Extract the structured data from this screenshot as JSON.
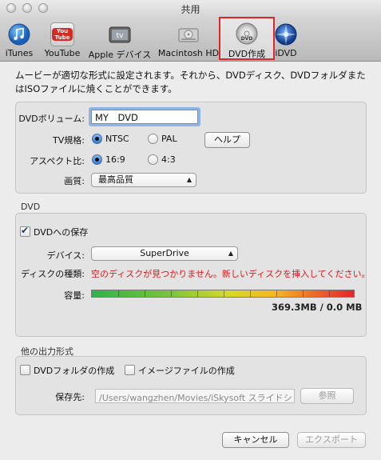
{
  "window": {
    "title": "共用"
  },
  "toolbar": {
    "items": [
      {
        "label": "iTunes"
      },
      {
        "label": "YouTube",
        "icon_text": "You Tube"
      },
      {
        "label": "Apple デバイス"
      },
      {
        "label": "Macintosh HD"
      },
      {
        "label": "DVD作成",
        "icon_text": "DVD",
        "selected": true
      },
      {
        "label": "iDVD"
      }
    ]
  },
  "description": "ムービーが適切な形式に設定されます。それから、DVDディスク、DVDフォルダまたはISOファイルに焼くことができます。",
  "settings": {
    "volume_label": "DVDボリューム:",
    "volume_value": "MY　DVD",
    "tv_label": "TV規格:",
    "tv_options": [
      "NTSC",
      "PAL"
    ],
    "tv_selected": "NTSC",
    "help_label": "ヘルプ",
    "aspect_label": "アスペクト比:",
    "aspect_options": [
      "16:9",
      "4:3"
    ],
    "aspect_selected": "16:9",
    "quality_label": "画質:",
    "quality_value": "最高品質"
  },
  "dvd": {
    "section_label": "DVD",
    "save_label": "DVDへの保存",
    "save_checked": true,
    "device_label": "デバイス:",
    "device_value": "SuperDrive",
    "disc_type_label": "ディスクの種類:",
    "disc_status": "空のディスクが見つかりません。新しいディスクを挿入してください。",
    "capacity_label": "容量:",
    "capacity_text": "369.3MB / 0.0 MB"
  },
  "other": {
    "section_label": "他の出力形式",
    "folder_label": "DVDフォルダの作成",
    "folder_checked": false,
    "image_label": "イメージファイルの作成",
    "image_checked": false,
    "save_to_label": "保存先:",
    "save_to_path": "/Users/wangzhen/Movies/iSkysoft スライドシ",
    "browse_label": "参照"
  },
  "footer": {
    "cancel_label": "キャンセル",
    "export_label": "エクスポート"
  },
  "colors": {
    "error_text": "#e3161b",
    "selected_outline": "#e0242a",
    "focus_ring": "#8db5e7"
  }
}
